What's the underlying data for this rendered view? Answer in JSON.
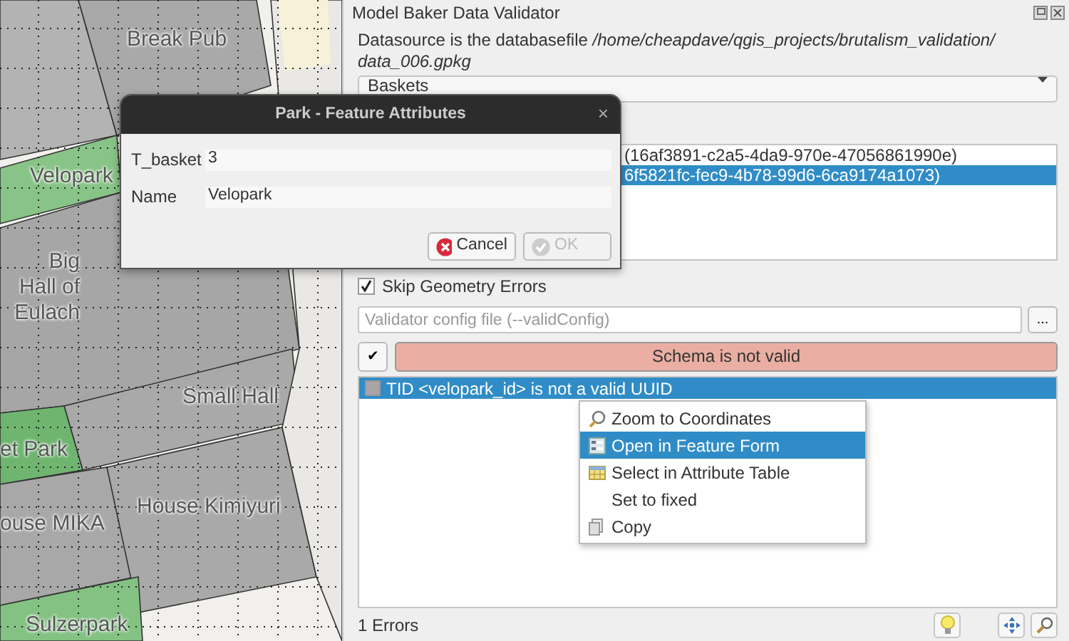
{
  "map": {
    "labels": [
      {
        "text": "Break Pub"
      },
      {
        "text": "Velopark"
      },
      {
        "text": "Big Hall of Eulach"
      },
      {
        "text": "Small Hall"
      },
      {
        "text": "et Park"
      },
      {
        "text": "ouse MIKA"
      },
      {
        "text": "House Kimiyuri"
      },
      {
        "text": "Sulzerpark"
      }
    ]
  },
  "panel": {
    "title": "Model Baker Data Validator",
    "datasource_text": "Datasource is the databasefile */home/cheapdave/qgis_projects/brutalism_validation/ data_006.gpkg*",
    "baskets_combo": {
      "value": "Baskets"
    },
    "basket_list": [
      {
        "text": "(16af3891-c2a5-4da9-970e-47056861990e)",
        "selected": false
      },
      {
        "text": "6f5821fc-fec9-4b78-99d6-6ca9174a1073)",
        "selected": true
      }
    ],
    "skip_geometry_errors": {
      "label": "Skip Geometry Errors",
      "checked": true
    },
    "config_field": {
      "placeholder": "Validator config file (--validConfig)"
    },
    "browse_button": "...",
    "check_button": "✔",
    "status": {
      "text": "Schema is not valid",
      "valid": false
    },
    "results": [
      {
        "text": "TID <velopark_id> is not a valid UUID",
        "selected": true
      }
    ],
    "error_count": "1 Errors"
  },
  "dialog": {
    "title": "Park - Feature Attributes",
    "close": "×",
    "fields": [
      {
        "label": "T_basket",
        "value": "3"
      },
      {
        "label": "Name",
        "value": "Velopark"
      }
    ],
    "buttons": [
      {
        "kind": "cancel",
        "label": "Cancel",
        "disabled": false
      },
      {
        "kind": "ok",
        "label": "OK",
        "disabled": true
      }
    ]
  },
  "context_menu": [
    {
      "kind": "zoom",
      "label": "Zoom to Coordinates",
      "selected": false
    },
    {
      "kind": "form",
      "label": "Open in Feature Form",
      "selected": true
    },
    {
      "kind": "table",
      "label": "Select in Attribute Table",
      "selected": false
    },
    {
      "kind": "none",
      "label": "Set to fixed",
      "selected": false
    },
    {
      "kind": "copy",
      "label": "Copy",
      "selected": false
    }
  ]
}
